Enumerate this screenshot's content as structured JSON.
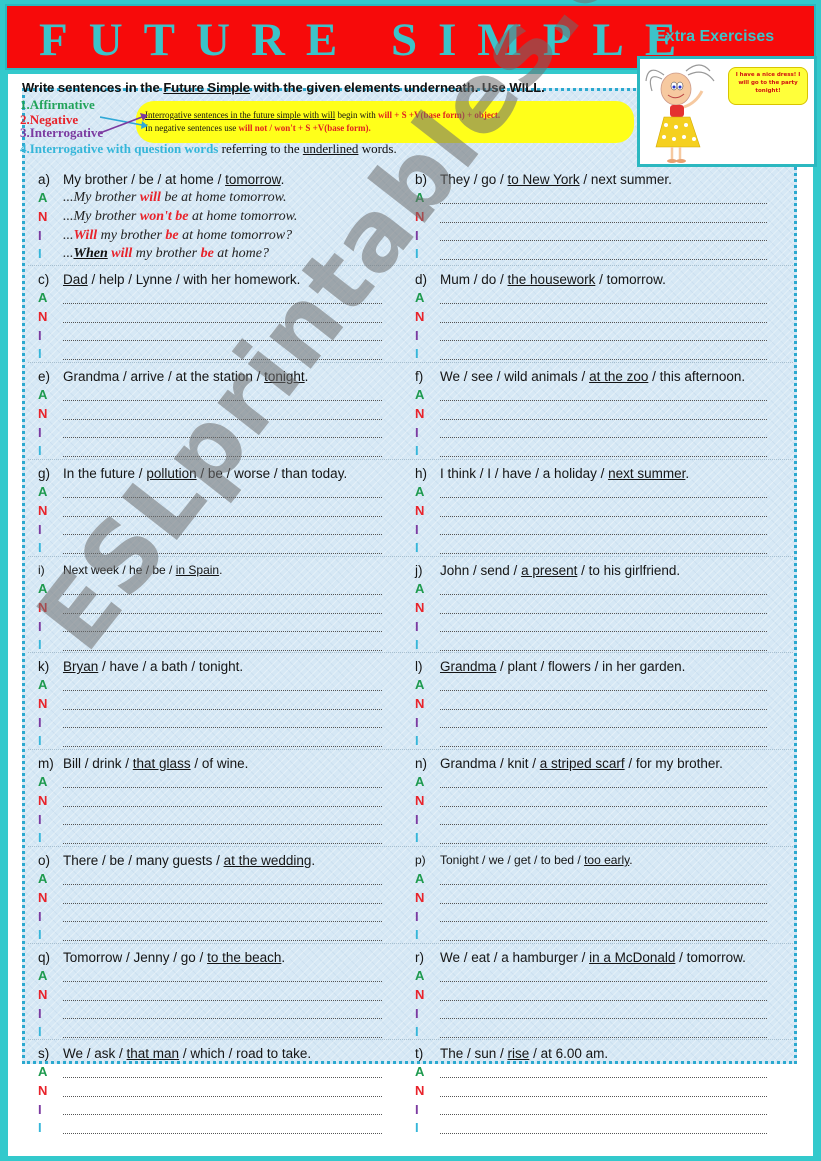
{
  "header": {
    "title": "FUTURE SIMPLE",
    "subtitle": "Extra Exercises"
  },
  "instructions": {
    "pre": "Write sentences in the ",
    "underlined": "Future Simple",
    "post": " with the given elements underneath. Use WILL."
  },
  "legend": {
    "item1": "1.Affirmative",
    "item2": "2.Negative",
    "item3": "3.Interrogative",
    "item4_colored": "4.Interrogative with question words",
    "item4_rest_pre": " referring to the ",
    "item4_underlined": "underlined",
    "item4_rest_post": " words."
  },
  "note": {
    "line1_underlined": "Interrogative sentences in the future simple with will",
    "line1_mid": " begin with ",
    "line1_red": "will + S +V(base form) + object.",
    "line2_plain": "In negative sentences use ",
    "line2_red": "will not / won't + S +V(base form)."
  },
  "cartoon": {
    "speech": "I have a nice dress! I will go to the party tonight!"
  },
  "row_tags": [
    "A",
    "N",
    "I",
    "I"
  ],
  "example": {
    "letter": "a)",
    "parts": [
      {
        "text": "My brother / be / at home / "
      },
      {
        "text": "tomorrow",
        "u": true
      },
      {
        "text": "."
      }
    ],
    "answers": {
      "A": {
        "pre": "...My brother ",
        "hl": "will",
        "post": " be at home tomorrow."
      },
      "N": {
        "pre": "...My brother ",
        "hl": "won't be",
        "post": " at home tomorrow."
      },
      "I1": {
        "pre": "...",
        "hl": "Will",
        "mid": " my brother ",
        "hl2": "be",
        "post": " at home tomorrow?"
      },
      "I2": {
        "pre": "...",
        "ul": "When",
        "sp": " ",
        "hl": "will",
        "mid": " my brother ",
        "hl2": "be",
        "post": " at home?"
      }
    }
  },
  "exercises": [
    {
      "letter": "b)",
      "parts": [
        {
          "text": "They / go / "
        },
        {
          "text": "to New York",
          "u": true
        },
        {
          "text": " / next summer."
        }
      ]
    },
    {
      "letter": "c)",
      "parts": [
        {
          "text": "Dad",
          "u": true
        },
        {
          "text": " / help / Lynne / with her homework."
        }
      ]
    },
    {
      "letter": "d)",
      "parts": [
        {
          "text": "Mum / do / "
        },
        {
          "text": "the housework",
          "u": true
        },
        {
          "text": " / tomorrow."
        }
      ]
    },
    {
      "letter": "e)",
      "parts": [
        {
          "text": "Grandma / arrive / at the station / "
        },
        {
          "text": "tonight",
          "u": true
        },
        {
          "text": "."
        }
      ]
    },
    {
      "letter": "f)",
      "parts": [
        {
          "text": "We / see / wild animals / "
        },
        {
          "text": "at the zoo",
          "u": true
        },
        {
          "text": " / this afternoon."
        }
      ]
    },
    {
      "letter": "g)",
      "parts": [
        {
          "text": "In the future / "
        },
        {
          "text": "pollution",
          "u": true
        },
        {
          "text": " / be / worse / than today."
        }
      ]
    },
    {
      "letter": "h)",
      "parts": [
        {
          "text": "I think / I / have / a holiday / "
        },
        {
          "text": "next summer",
          "u": true
        },
        {
          "text": "."
        }
      ]
    },
    {
      "letter": "i)",
      "small": true,
      "parts": [
        {
          "text": "Next week / he / be / "
        },
        {
          "text": "in Spain",
          "u": true
        },
        {
          "text": "."
        }
      ]
    },
    {
      "letter": "j)",
      "parts": [
        {
          "text": "John / send / "
        },
        {
          "text": "a present",
          "u": true
        },
        {
          "text": " / to his girlfriend."
        }
      ]
    },
    {
      "letter": "k)",
      "parts": [
        {
          "text": "Bryan",
          "u": true
        },
        {
          "text": " / have / a bath / tonight."
        }
      ]
    },
    {
      "letter": "l)",
      "parts": [
        {
          "text": "Grandma",
          "u": true
        },
        {
          "text": " / plant / flowers / in her garden."
        }
      ]
    },
    {
      "letter": "m)",
      "parts": [
        {
          "text": "Bill / drink / "
        },
        {
          "text": "that glass",
          "u": true
        },
        {
          "text": " / of wine."
        }
      ]
    },
    {
      "letter": "n)",
      "parts": [
        {
          "text": "Grandma / knit / "
        },
        {
          "text": "a striped scarf",
          "u": true
        },
        {
          "text": " / for my brother."
        }
      ]
    },
    {
      "letter": "o)",
      "parts": [
        {
          "text": "There / be / many guests / "
        },
        {
          "text": "at the wedding",
          "u": true
        },
        {
          "text": "."
        }
      ]
    },
    {
      "letter": "p)",
      "small": true,
      "parts": [
        {
          "text": "Tonight / we / get / to bed / "
        },
        {
          "text": "too early",
          "u": true
        },
        {
          "text": "."
        }
      ]
    },
    {
      "letter": "q)",
      "parts": [
        {
          "text": "Tomorrow / Jenny / go / "
        },
        {
          "text": "to the beach",
          "u": true
        },
        {
          "text": "."
        }
      ]
    },
    {
      "letter": "r)",
      "parts": [
        {
          "text": "We / eat / a hamburger / "
        },
        {
          "text": "in a McDonald",
          "u": true
        },
        {
          "text": " / tomorrow."
        }
      ]
    },
    {
      "letter": "s)",
      "parts": [
        {
          "text": "We / ask / "
        },
        {
          "text": "that man",
          "u": true
        },
        {
          "text": " / which / road to take."
        }
      ]
    },
    {
      "letter": "t)",
      "parts": [
        {
          "text": "The / sun / "
        },
        {
          "text": "rise",
          "u": true
        },
        {
          "text": " / at 6.00 am."
        }
      ]
    }
  ],
  "watermark": "ESLprintables.com",
  "colors": {
    "border_teal": "#33c9cc",
    "title_red": "#f70a0a",
    "affirmative": "#1e9a4e",
    "negative": "#e8222a",
    "interrogative": "#7b3aa0",
    "wh_question": "#35b6d9"
  }
}
